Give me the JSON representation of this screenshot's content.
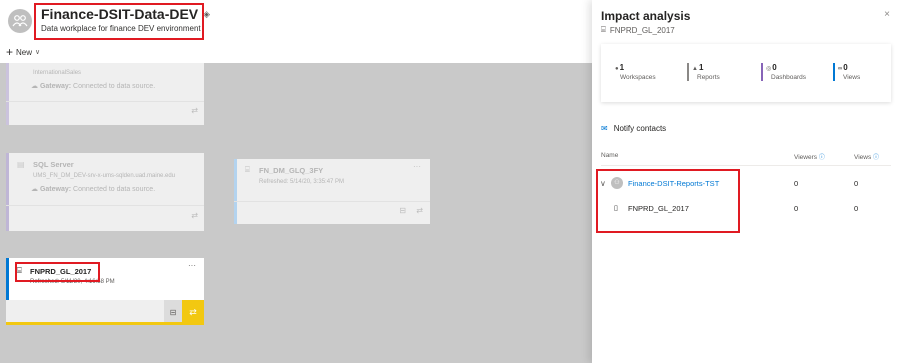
{
  "workspace": {
    "name": "Finance-DSIT-Data-DEV",
    "description": "Data workplace for finance DEV environment",
    "icon": "people-icon"
  },
  "toolbar": {
    "new_label": "New"
  },
  "cards": [
    {
      "type_label": "",
      "title": "InternationalSales",
      "gateway_label": "Gateway:",
      "gateway_status": "Connected to data source."
    },
    {
      "type_label": "SQL Server",
      "subtitle": "UMS_FN_DM_DEV-srv-x-ums-sqlden.uad.maine.edu",
      "gateway_label": "Gateway:",
      "gateway_status": "Connected to data source."
    },
    {
      "title": "FN_DM_GLQ_3FY",
      "refreshed": "Refreshed: 5/14/20, 3:35:47 PM",
      "more": "···"
    },
    {
      "title": "FNPRD_GL_2017",
      "refreshed": "Refreshed: 5/11/20, 4:16:58 PM",
      "more": "···"
    }
  ],
  "impact_panel": {
    "title": "Impact analysis",
    "subtitle": "FNPRD_GL_2017",
    "close": "×",
    "stats": [
      {
        "count": "1",
        "label": "Workspaces",
        "color": "#8a8886"
      },
      {
        "count": "1",
        "label": "Reports",
        "color": "#0078d4"
      },
      {
        "count": "0",
        "label": "Dashboards",
        "color": "#8764b8"
      },
      {
        "count": "0",
        "label": "Views",
        "color": "#0078d4"
      }
    ],
    "notify_label": "Notify contacts",
    "columns": {
      "name": "Name",
      "viewers": "Viewers",
      "views": "Views"
    },
    "rows": [
      {
        "name": "Finance-DSIT-Reports-TST",
        "viewers": "0",
        "views": "0",
        "kind": "workspace"
      },
      {
        "name": "FNPRD_GL_2017",
        "viewers": "0",
        "views": "0",
        "kind": "report"
      }
    ]
  },
  "colors": {
    "accent": "#0078d4",
    "highlight": "#e01a22",
    "action_yellow": "#f2c811"
  }
}
